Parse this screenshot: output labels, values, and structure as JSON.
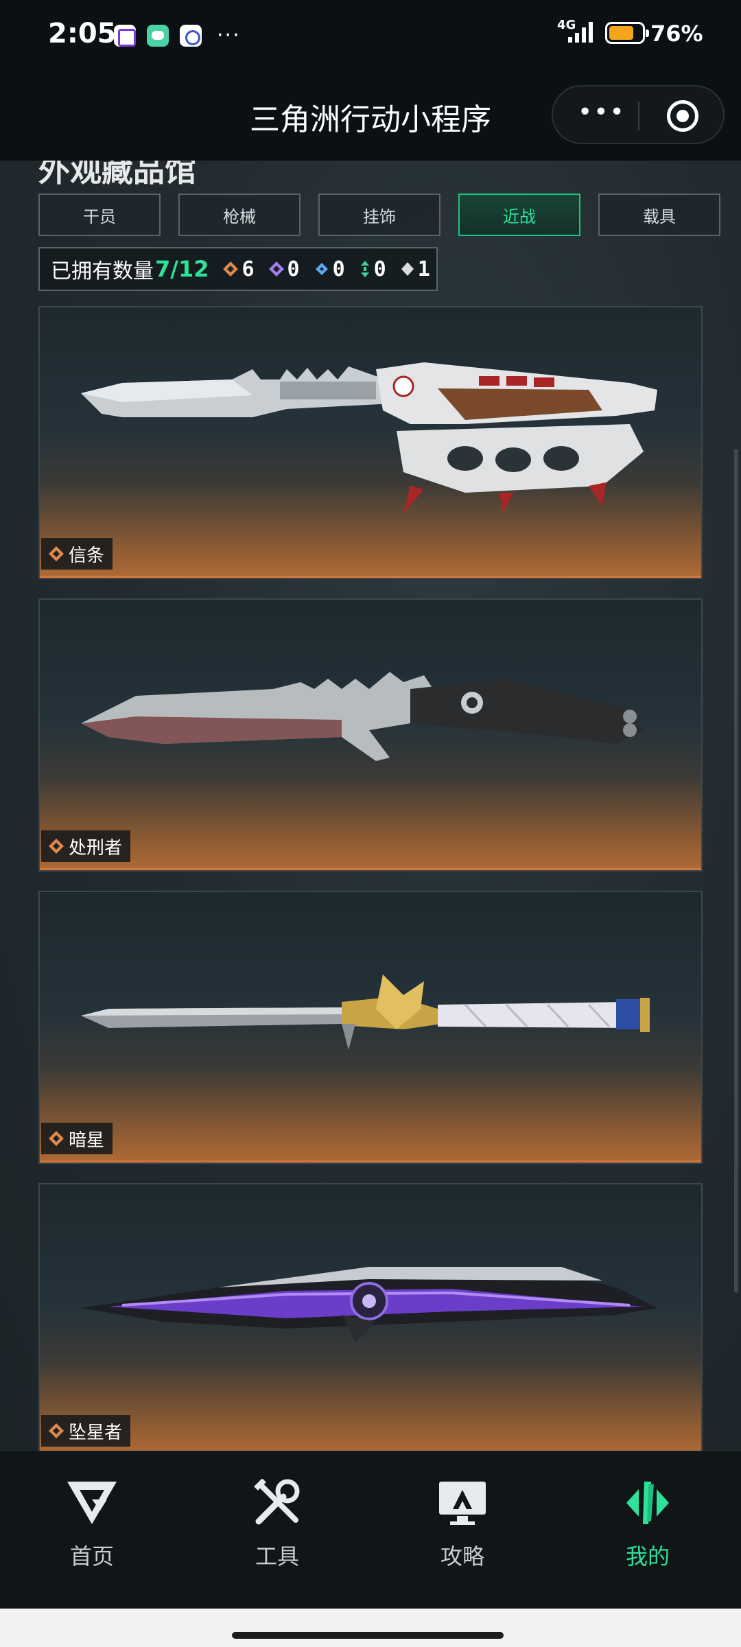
{
  "status_bar": {
    "time": "2:05",
    "more": "···",
    "network": "4G",
    "battery_level": 0.76,
    "battery_text": "76%"
  },
  "title_bar": {
    "title": "三角洲行动小程序",
    "more_icon": "more-dots-icon",
    "close_icon": "target-icon"
  },
  "section": {
    "title": "外观藏品馆"
  },
  "tabs": [
    {
      "label": "干员",
      "active": false
    },
    {
      "label": "枪械",
      "active": false
    },
    {
      "label": "挂饰",
      "active": false
    },
    {
      "label": "近战",
      "active": true
    },
    {
      "label": "载具",
      "active": false
    }
  ],
  "owned": {
    "label": "已拥有数量",
    "count": "7/12",
    "rarities": [
      {
        "color": "#e0894a",
        "icon": "orange-diamond-icon",
        "value": "6"
      },
      {
        "color": "#a67bf0",
        "icon": "purple-diamond-icon",
        "value": "0"
      },
      {
        "color": "#5aa8f0",
        "icon": "blue-diamond-icon",
        "value": "0"
      },
      {
        "color": "#3dd39a",
        "icon": "green-diamond-icon",
        "value": "0"
      },
      {
        "color": "#d9dde0",
        "icon": "white-diamond-icon",
        "value": "1"
      }
    ]
  },
  "items": [
    {
      "name": "信条",
      "rarity": "orange",
      "icon": "knuckle-knife-image"
    },
    {
      "name": "处刑者",
      "rarity": "orange",
      "icon": "combat-knife-image"
    },
    {
      "name": "暗星",
      "rarity": "orange",
      "icon": "eagle-knife-image"
    },
    {
      "name": "坠星者",
      "rarity": "orange",
      "icon": "purple-knife-image"
    }
  ],
  "nav": [
    {
      "label": "首页",
      "icon": "home-logo-icon",
      "active": false
    },
    {
      "label": "工具",
      "icon": "tools-icon",
      "active": false
    },
    {
      "label": "攻略",
      "icon": "guide-monitor-icon",
      "active": false
    },
    {
      "label": "我的",
      "icon": "profile-logo-icon",
      "active": true
    }
  ],
  "colors": {
    "accent": "#2de39a",
    "orange_rarity": "#e0894a"
  }
}
